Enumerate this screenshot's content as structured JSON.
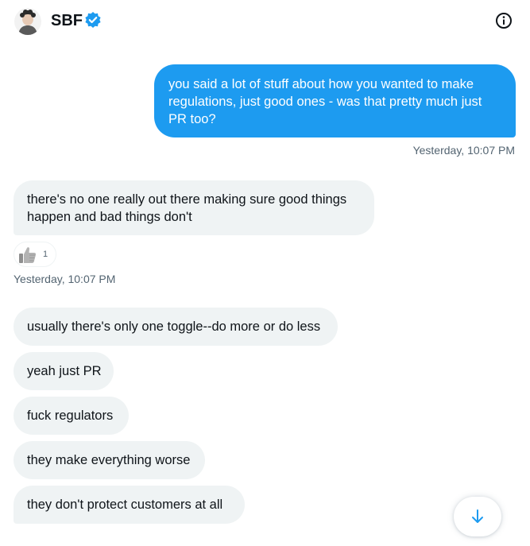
{
  "header": {
    "name": "SBF",
    "avatar_icon": "avatar-icon",
    "verified_icon": "verified-badge-icon",
    "info_icon": "info-icon"
  },
  "colors": {
    "outgoing_bubble": "#1d9bf0",
    "incoming_bubble": "#eff3f4",
    "timestamp": "#536471"
  },
  "messages": [
    {
      "direction": "outgoing",
      "lines": [
        "you said a lot of stuff about how you wanted to make",
        "regulations, just good ones - was that pretty much just",
        "PR too?"
      ],
      "timestamp": "Yesterday, 10:07 PM"
    },
    {
      "direction": "incoming",
      "lines": [
        "there's no one really out there making sure good things",
        "happen and bad things don't"
      ],
      "reaction": {
        "icon": "thumbs-up-icon",
        "count": "1"
      },
      "timestamp": "Yesterday, 10:07 PM"
    },
    {
      "direction": "incoming",
      "lines": [
        "usually there's only one toggle--do more or do less"
      ]
    },
    {
      "direction": "incoming",
      "lines": [
        "yeah just PR"
      ]
    },
    {
      "direction": "incoming",
      "lines": [
        "fuck regulators"
      ]
    },
    {
      "direction": "incoming",
      "lines": [
        "they make everything worse"
      ]
    },
    {
      "direction": "incoming",
      "lines": [
        "they don't protect customers at all"
      ]
    }
  ],
  "scroll_button": {
    "icon": "arrow-down-icon"
  }
}
